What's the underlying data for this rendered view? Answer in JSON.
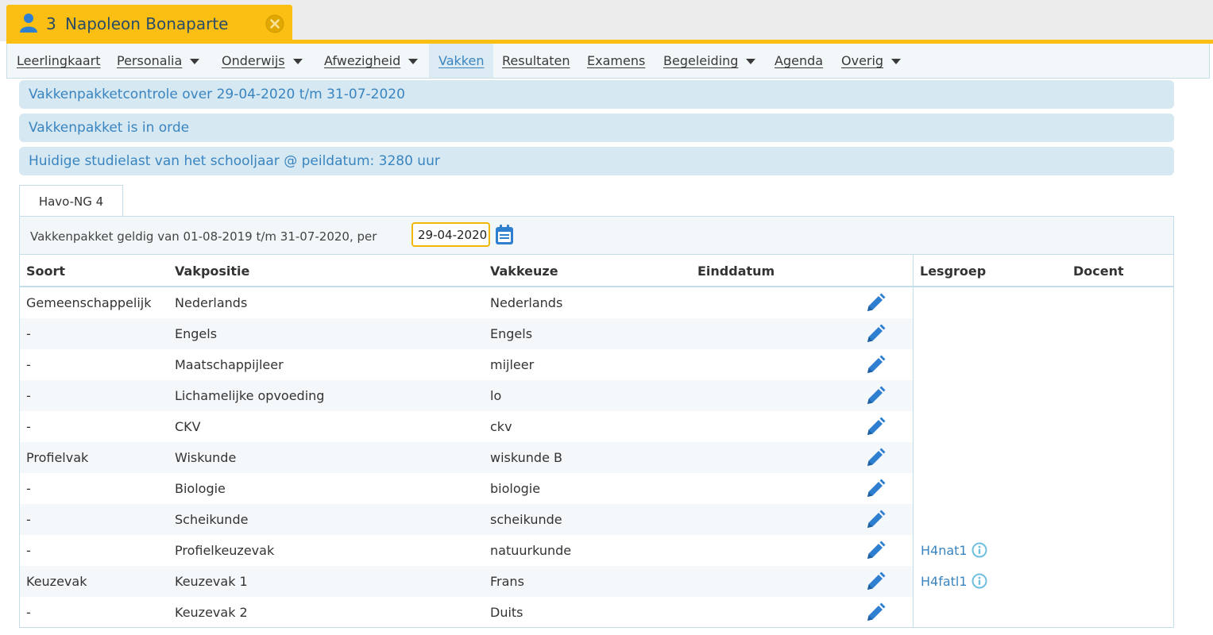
{
  "student": {
    "number": "3",
    "name": "Napoleon Bonaparte"
  },
  "menu": [
    {
      "label": "Leerlingkaart",
      "dropdown": false,
      "active": false
    },
    {
      "label": "Personalia",
      "dropdown": true,
      "active": false
    },
    {
      "label": "Onderwijs",
      "dropdown": true,
      "active": false
    },
    {
      "label": "Afwezigheid",
      "dropdown": true,
      "active": false
    },
    {
      "label": "Vakken",
      "dropdown": false,
      "active": true
    },
    {
      "label": "Resultaten",
      "dropdown": false,
      "active": false
    },
    {
      "label": "Examens",
      "dropdown": false,
      "active": false
    },
    {
      "label": "Begeleiding",
      "dropdown": true,
      "active": false
    },
    {
      "label": "Agenda",
      "dropdown": false,
      "active": false
    },
    {
      "label": "Overig",
      "dropdown": true,
      "active": false
    }
  ],
  "info_bars": [
    "Vakkenpakketcontrole over 29-04-2020 t/m 31-07-2020",
    "Vakkenpakket is in orde",
    "Huidige studielast van het schooljaar @ peildatum: 3280 uur"
  ],
  "package_tab": "Havo-NG 4",
  "validity": {
    "text": "Vakkenpakket geldig van 01-08-2019 t/m 31-07-2020, per",
    "date": "29-04-2020"
  },
  "columns": {
    "soort": "Soort",
    "vakpositie": "Vakpositie",
    "vakkeuze": "Vakkeuze",
    "einddatum": "Einddatum",
    "lesgroep": "Lesgroep",
    "docent": "Docent"
  },
  "rows": [
    {
      "soort": "Gemeenschappelijk",
      "vakpositie": "Nederlands",
      "vakkeuze": "Nederlands",
      "einddatum": "",
      "lesgroep": "",
      "docent": ""
    },
    {
      "soort": "-",
      "vakpositie": "Engels",
      "vakkeuze": "Engels",
      "einddatum": "",
      "lesgroep": "",
      "docent": ""
    },
    {
      "soort": "-",
      "vakpositie": "Maatschappijleer",
      "vakkeuze": "mijleer",
      "einddatum": "",
      "lesgroep": "",
      "docent": ""
    },
    {
      "soort": "-",
      "vakpositie": "Lichamelijke opvoeding",
      "vakkeuze": "lo",
      "einddatum": "",
      "lesgroep": "",
      "docent": ""
    },
    {
      "soort": "-",
      "vakpositie": "CKV",
      "vakkeuze": "ckv",
      "einddatum": "",
      "lesgroep": "",
      "docent": ""
    },
    {
      "soort": "Profielvak",
      "vakpositie": "Wiskunde",
      "vakkeuze": "wiskunde B",
      "einddatum": "",
      "lesgroep": "",
      "docent": ""
    },
    {
      "soort": "-",
      "vakpositie": "Biologie",
      "vakkeuze": "biologie",
      "einddatum": "",
      "lesgroep": "",
      "docent": ""
    },
    {
      "soort": "-",
      "vakpositie": "Scheikunde",
      "vakkeuze": "scheikunde",
      "einddatum": "",
      "lesgroep": "",
      "docent": ""
    },
    {
      "soort": "-",
      "vakpositie": "Profielkeuzevak",
      "vakkeuze": "natuurkunde",
      "einddatum": "",
      "lesgroep": "H4nat1",
      "docent": ""
    },
    {
      "soort": "Keuzevak",
      "vakpositie": "Keuzevak 1",
      "vakkeuze": "Frans",
      "einddatum": "",
      "lesgroep": "H4fatl1",
      "docent": ""
    },
    {
      "soort": "-",
      "vakpositie": "Keuzevak 2",
      "vakkeuze": "Duits",
      "einddatum": "",
      "lesgroep": "",
      "docent": ""
    }
  ],
  "colors": {
    "accent": "#fbbf14",
    "link": "#3a85c0",
    "panel": "#d6e8f2",
    "icon_blue": "#2f7fd1"
  },
  "icons": {
    "student": "user-icon",
    "close": "close-circle-icon",
    "calendar": "calendar-icon",
    "edit": "pencil-icon",
    "info": "info-circle-icon",
    "dropdown": "caret-down-icon"
  }
}
